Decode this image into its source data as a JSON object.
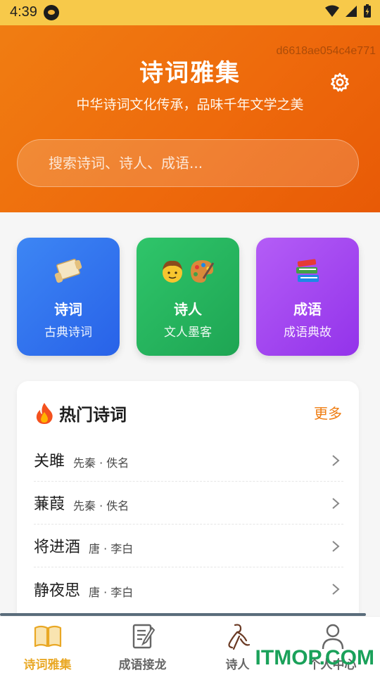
{
  "status_bar": {
    "time": "4:39"
  },
  "header": {
    "watermark_id": "d6618ae054c4e771",
    "title": "诗词雅集",
    "subtitle": "中华诗词文化传承，品味千年文学之美",
    "search_placeholder": "搜索诗词、诗人、成语..."
  },
  "categories": [
    {
      "title": "诗词",
      "subtitle": "古典诗词",
      "icon": "scroll-icon",
      "color": "#2f6ff0"
    },
    {
      "title": "诗人",
      "subtitle": "文人墨客",
      "icon": "artist-icon",
      "color": "#22b25c"
    },
    {
      "title": "成语",
      "subtitle": "成语典故",
      "icon": "books-icon",
      "color": "#a146f2"
    }
  ],
  "hot_poems": {
    "title": "热门诗词",
    "more_label": "更多",
    "items": [
      {
        "title": "关雎",
        "meta": "先秦 · 佚名"
      },
      {
        "title": "蒹葭",
        "meta": "先秦 · 佚名"
      },
      {
        "title": "将进酒",
        "meta": "唐 · 李白"
      },
      {
        "title": "静夜思",
        "meta": "唐 · 李白"
      }
    ]
  },
  "bottom_nav": {
    "items": [
      {
        "label": "诗词雅集",
        "icon": "book-icon",
        "active": true
      },
      {
        "label": "成语接龙",
        "icon": "edit-doc-icon",
        "active": false
      },
      {
        "label": "诗人",
        "icon": "poet-icon",
        "active": false
      },
      {
        "label": "个人中心",
        "icon": "person-icon",
        "active": false
      }
    ]
  },
  "branding": {
    "site_watermark": "ITMOP.COM"
  },
  "colors": {
    "accent": "#ef7d12",
    "nav_active": "#e9a825"
  }
}
